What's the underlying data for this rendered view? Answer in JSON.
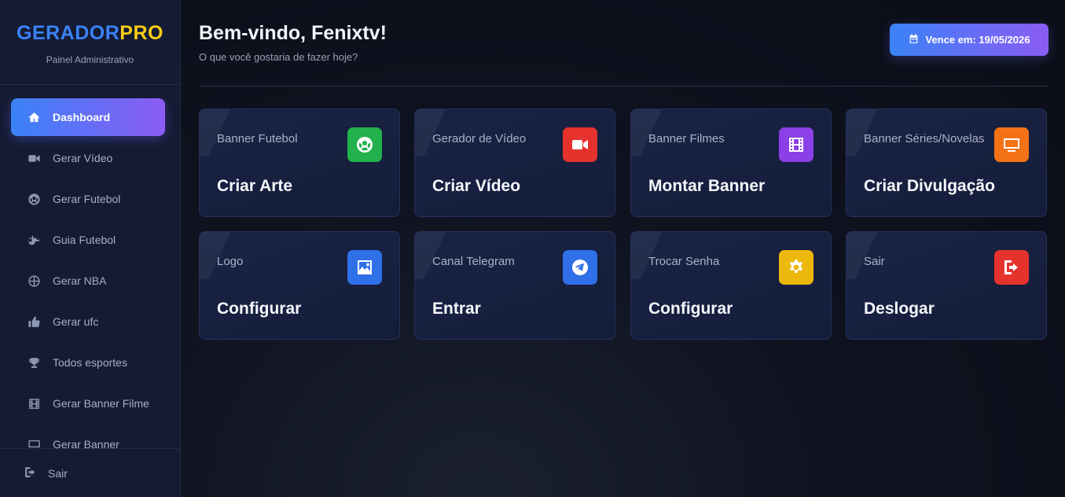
{
  "brand": {
    "part1": "GERADOR",
    "part2": "PRO",
    "subtitle": "Painel Administrativo"
  },
  "nav": [
    {
      "label": "Dashboard",
      "icon": "home-icon",
      "active": true
    },
    {
      "label": "Gerar Vídeo",
      "icon": "video-camera-icon"
    },
    {
      "label": "Gerar Futebol",
      "icon": "soccer-ball-icon"
    },
    {
      "label": "Guia Futebol",
      "icon": "whistle-icon"
    },
    {
      "label": "Gerar NBA",
      "icon": "basketball-icon"
    },
    {
      "label": "Gerar ufc",
      "icon": "thumbs-up-icon"
    },
    {
      "label": "Todos esportes",
      "icon": "trophy-icon"
    },
    {
      "label": "Gerar Banner Filme",
      "icon": "film-icon"
    },
    {
      "label": "Gerar Banner",
      "icon": "tv-icon"
    }
  ],
  "logout": {
    "label": "Sair",
    "icon": "logout-icon"
  },
  "header": {
    "title": "Bem-vindo, Fenixtv!",
    "subtitle": "O que você gostaria de fazer hoje?",
    "expiry": "Vence em: 19/05/2026"
  },
  "cards": [
    {
      "label": "Banner Futebol",
      "action": "Criar Arte",
      "icon": "soccer-ball-icon",
      "color": "#22b14c"
    },
    {
      "label": "Gerador de Vídeo",
      "action": "Criar Vídeo",
      "icon": "video-camera-icon",
      "color": "#e5322d"
    },
    {
      "label": "Banner Filmes",
      "action": "Montar Banner",
      "icon": "film-icon",
      "color": "#8b3fe6"
    },
    {
      "label": "Banner Séries/Novelas",
      "action": "Criar Divulgação",
      "icon": "tv-icon",
      "color": "#f47216"
    },
    {
      "label": "Logo",
      "action": "Configurar",
      "icon": "image-icon",
      "color": "#2f6fe8"
    },
    {
      "label": "Canal Telegram",
      "action": "Entrar",
      "icon": "telegram-icon",
      "color": "#2f6fe8"
    },
    {
      "label": "Trocar Senha",
      "action": "Configurar",
      "icon": "gear-icon",
      "color": "#ecb80c"
    },
    {
      "label": "Sair",
      "action": "Deslogar",
      "icon": "logout-icon",
      "color": "#e5322d"
    }
  ]
}
